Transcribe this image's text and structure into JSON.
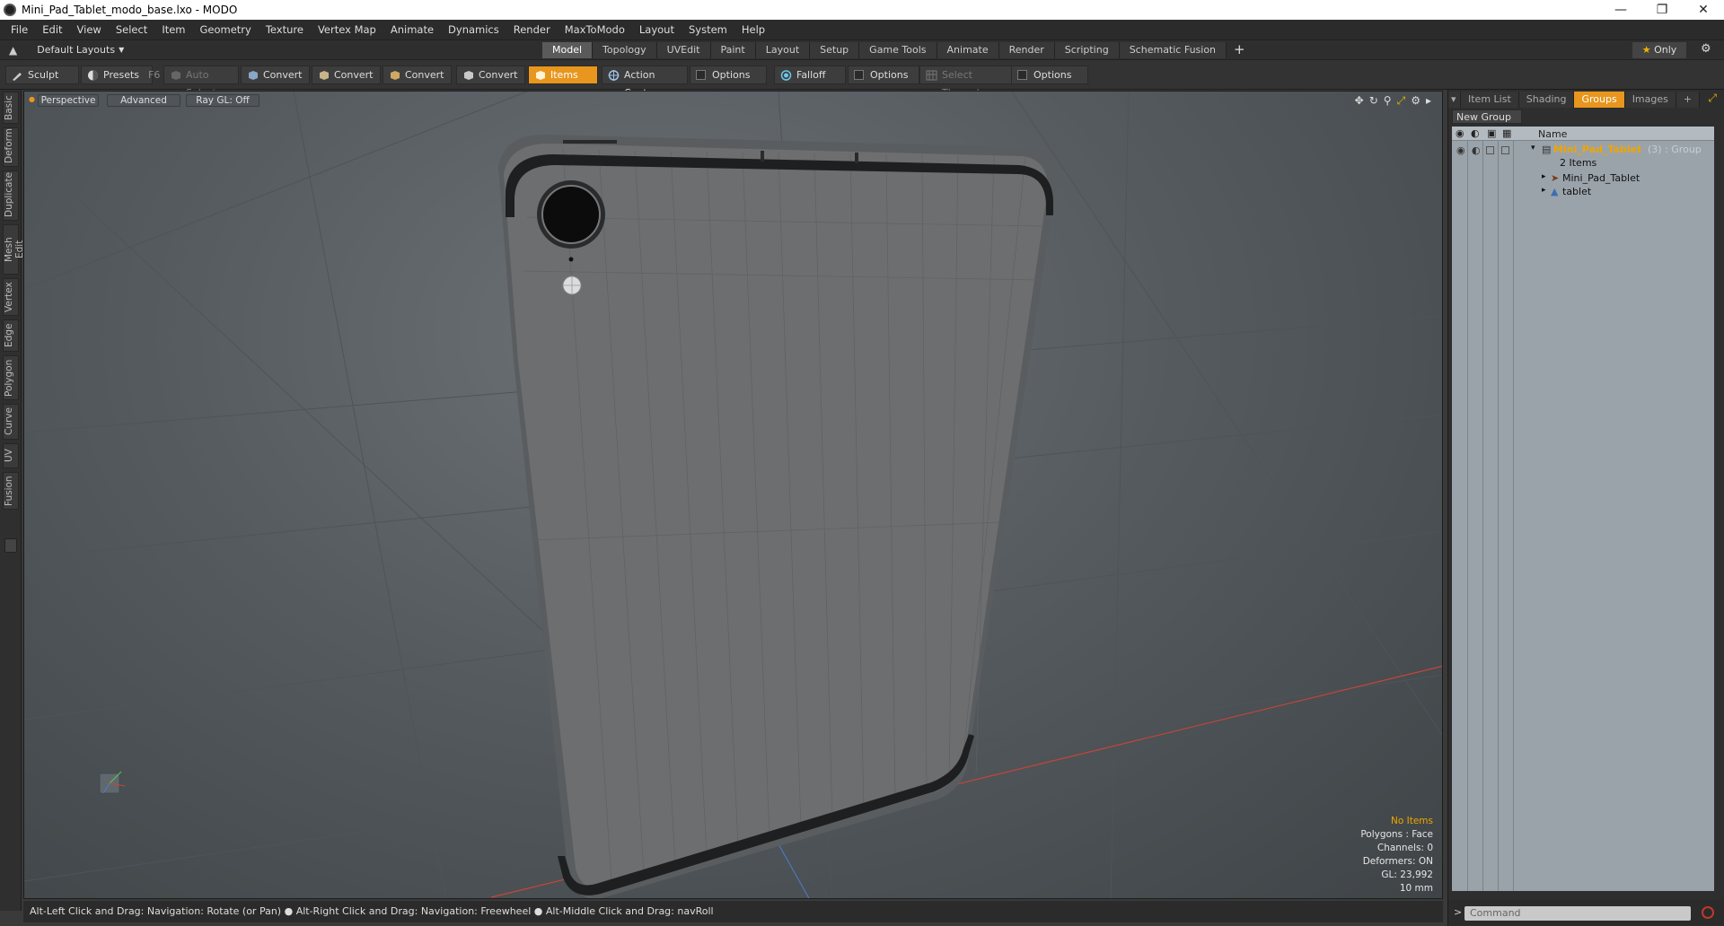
{
  "window": {
    "title": "Mini_Pad_Tablet_modo_base.lxo - MODO",
    "minimize": "—",
    "maximize": "❐",
    "close": "✕"
  },
  "menu": [
    "File",
    "Edit",
    "View",
    "Select",
    "Item",
    "Geometry",
    "Texture",
    "Vertex Map",
    "Animate",
    "Dynamics",
    "Render",
    "MaxToModo",
    "Layout",
    "System",
    "Help"
  ],
  "layoutbar": {
    "layout_select": "Default Layouts",
    "tabs": [
      "Model",
      "Topology",
      "UVEdit",
      "Paint",
      "Layout",
      "Setup",
      "Game Tools",
      "Animate",
      "Render",
      "Scripting",
      "Schematic Fusion"
    ],
    "active_tab": "Model",
    "add_tab": "+",
    "only_label": "Only",
    "only_star": "★"
  },
  "toolbar": {
    "sculpt": "Sculpt",
    "presets": "Presets",
    "presets_key": "F6",
    "auto_select": "Auto Select",
    "convert1": "Convert",
    "convert2": "Convert",
    "convert3": "Convert",
    "convert4": "Convert",
    "items": "Items",
    "action_center": "Action Center",
    "options1": "Options",
    "falloff": "Falloff",
    "options2": "Options",
    "select_through": "Select Through",
    "options3": "Options"
  },
  "left_tabs": [
    "Basic",
    "Deform",
    "Duplicate",
    "Mesh Edit",
    "Vertex",
    "Edge",
    "Polygon",
    "Curve",
    "UV",
    "Fusion"
  ],
  "viewport": {
    "view_mode": "Perspective",
    "shading": "Advanced",
    "raygl": "Ray GL: Off",
    "hud": {
      "selection": "No Items",
      "polygons": "Polygons : Face",
      "channels": "Channels: 0",
      "deformers": "Deformers: ON",
      "gl": "GL: 23,992",
      "grid": "10 mm"
    }
  },
  "statusbar": {
    "text": "Alt-Left Click and Drag: Navigation: Rotate (or Pan) ●  Alt-Right Click and Drag: Navigation: Freewheel ●  Alt-Middle Click and Drag: navRoll"
  },
  "right_panel": {
    "tabs": [
      "Item List",
      "Shading",
      "Groups",
      "Images"
    ],
    "active_tab": "Groups",
    "add_tab": "+",
    "new_group": "New Group",
    "column_name": "Name",
    "group": {
      "name": "Mini_Pad_Tablet",
      "suffix": "(3) : Group",
      "count": "2 Items",
      "children": [
        "Mini_Pad_Tablet",
        "tablet"
      ]
    },
    "command_placeholder": "Command",
    "command_prompt": ">"
  },
  "colors": {
    "accent": "#e8961e",
    "viewport_bg": "#5a6064",
    "hud_warning": "#f0a500",
    "x_axis": "#c8443a"
  }
}
